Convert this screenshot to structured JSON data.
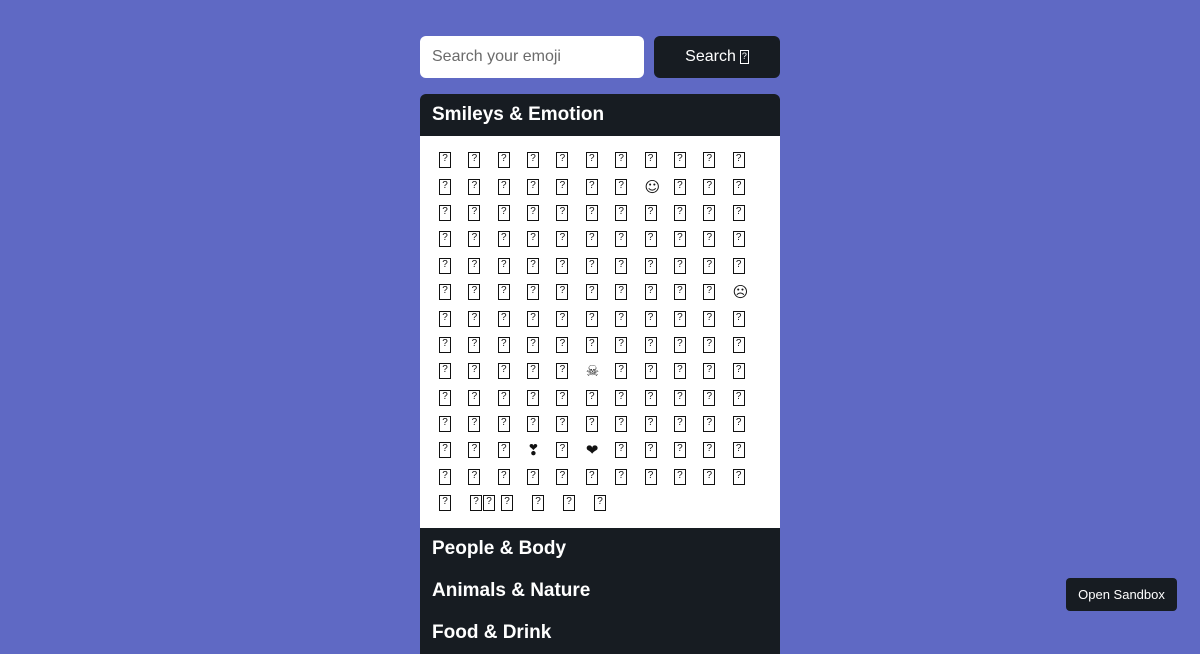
{
  "search": {
    "placeholder": "Search your emoji",
    "value": "",
    "button_label": "Search",
    "button_icon": "missing-glyph-box"
  },
  "categories": [
    {
      "label": "Smileys & Emotion",
      "expanded": true
    },
    {
      "label": "People & Body",
      "expanded": false
    },
    {
      "label": "Animals & Nature",
      "expanded": false
    },
    {
      "label": "Food & Drink",
      "expanded": false
    }
  ],
  "emoji_grid": [
    [
      "□",
      "□",
      "□",
      "□",
      "□",
      "□",
      "□",
      "□",
      "□",
      "□",
      "□"
    ],
    [
      "□",
      "□",
      "□",
      "□",
      "□",
      "□",
      "□",
      "☺",
      "□",
      "□",
      "□"
    ],
    [
      "□",
      "□",
      "□",
      "□",
      "□",
      "□",
      "□",
      "□",
      "□",
      "□",
      "□"
    ],
    [
      "□",
      "□",
      "□",
      "□",
      "□",
      "□",
      "□",
      "□",
      "□",
      "□",
      "□"
    ],
    [
      "□",
      "□",
      "□",
      "□",
      "□",
      "□",
      "□",
      "□",
      "□",
      "□",
      "□"
    ],
    [
      "□",
      "□",
      "□",
      "□",
      "□",
      "□",
      "□",
      "□",
      "□",
      "□",
      "☹"
    ],
    [
      "□",
      "□",
      "□",
      "□",
      "□",
      "□",
      "□",
      "□",
      "□",
      "□",
      "□"
    ],
    [
      "□",
      "□",
      "□",
      "□",
      "□",
      "□",
      "□",
      "□",
      "□",
      "□",
      "□"
    ],
    [
      "□",
      "□",
      "□",
      "□",
      "□",
      "☠",
      "□",
      "□",
      "□",
      "□",
      "□"
    ],
    [
      "□",
      "□",
      "□",
      "□",
      "□",
      "□",
      "□",
      "□",
      "□",
      "□",
      "□"
    ],
    [
      "□",
      "□",
      "□",
      "□",
      "□",
      "□",
      "□",
      "□",
      "□",
      "□",
      "□"
    ],
    [
      "□",
      "□",
      "□",
      "❣",
      "□",
      "❤",
      "□",
      "□",
      "□",
      "□",
      "□"
    ],
    [
      "□",
      "□",
      "□",
      "□",
      "□",
      "□",
      "□",
      "□",
      "□",
      "□",
      "□"
    ],
    [
      "□",
      "□□",
      "□",
      "□",
      "□",
      "□"
    ]
  ],
  "sandbox_button": {
    "label": "Open Sandbox"
  },
  "colors": {
    "background": "#5f69c4",
    "dark": "#171c22",
    "panel_body": "#ffffff"
  }
}
